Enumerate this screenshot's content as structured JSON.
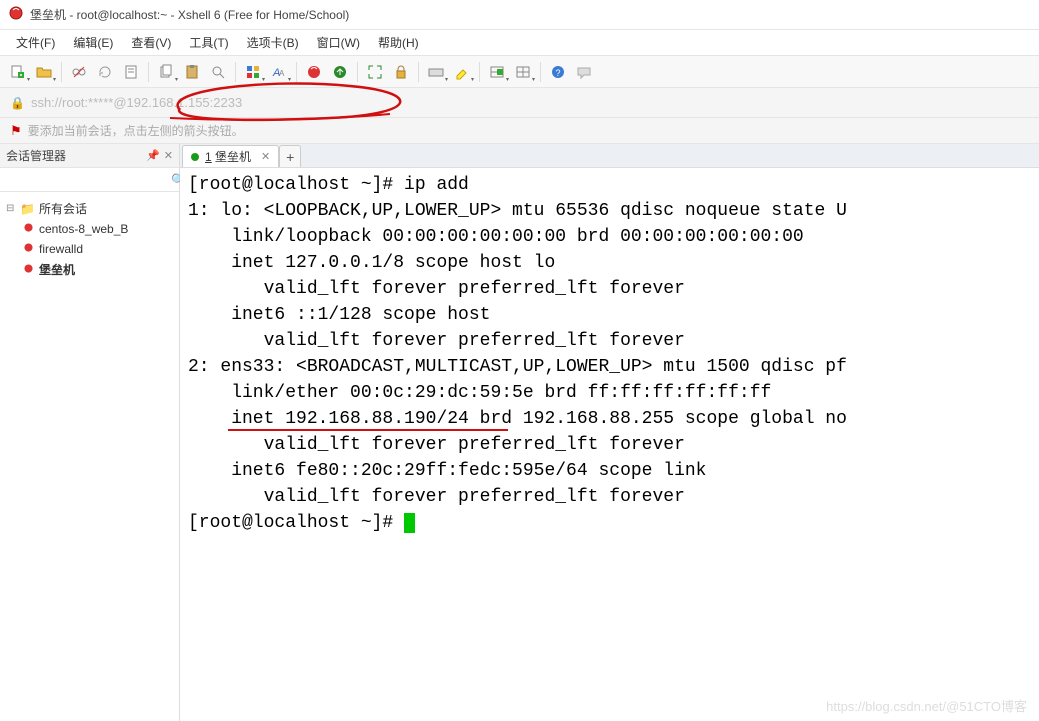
{
  "window": {
    "title": "堡垒机 - root@localhost:~ - Xshell 6 (Free for Home/School)"
  },
  "menu": {
    "items": [
      "文件(F)",
      "编辑(E)",
      "查看(V)",
      "工具(T)",
      "选项卡(B)",
      "窗口(W)",
      "帮助(H)"
    ]
  },
  "address": {
    "url": "ssh://root:*****@192.168.1.155:2233"
  },
  "hint": {
    "text": "要添加当前会话，点击左侧的箭头按钮。"
  },
  "session_panel": {
    "title": "会话管理器",
    "search_placeholder": "",
    "root": "所有会话",
    "items": [
      "centos-8_web_B",
      "firewalld",
      "堡垒机"
    ],
    "active_index": 2
  },
  "tabs": {
    "items": [
      {
        "index": "1",
        "label": "堡垒机",
        "connected": true
      }
    ]
  },
  "terminal": {
    "lines": [
      "[root@localhost ~]# ip add",
      "1: lo: <LOOPBACK,UP,LOWER_UP> mtu 65536 qdisc noqueue state U",
      "    link/loopback 00:00:00:00:00:00 brd 00:00:00:00:00:00",
      "    inet 127.0.0.1/8 scope host lo",
      "       valid_lft forever preferred_lft forever",
      "    inet6 ::1/128 scope host",
      "       valid_lft forever preferred_lft forever",
      "2: ens33: <BROADCAST,MULTICAST,UP,LOWER_UP> mtu 1500 qdisc pf",
      "    link/ether 00:0c:29:dc:59:5e brd ff:ff:ff:ff:ff:ff",
      "    inet 192.168.88.190/24 brd 192.168.88.255 scope global no",
      "       valid_lft forever preferred_lft forever",
      "    inet6 fe80::20c:29ff:fedc:595e/64 scope link",
      "       valid_lft forever preferred_lft forever",
      "[root@localhost ~]# "
    ]
  },
  "watermark": {
    "text_left": "https://blog.csdn.net/",
    "text_right": "@51CTO博客"
  }
}
